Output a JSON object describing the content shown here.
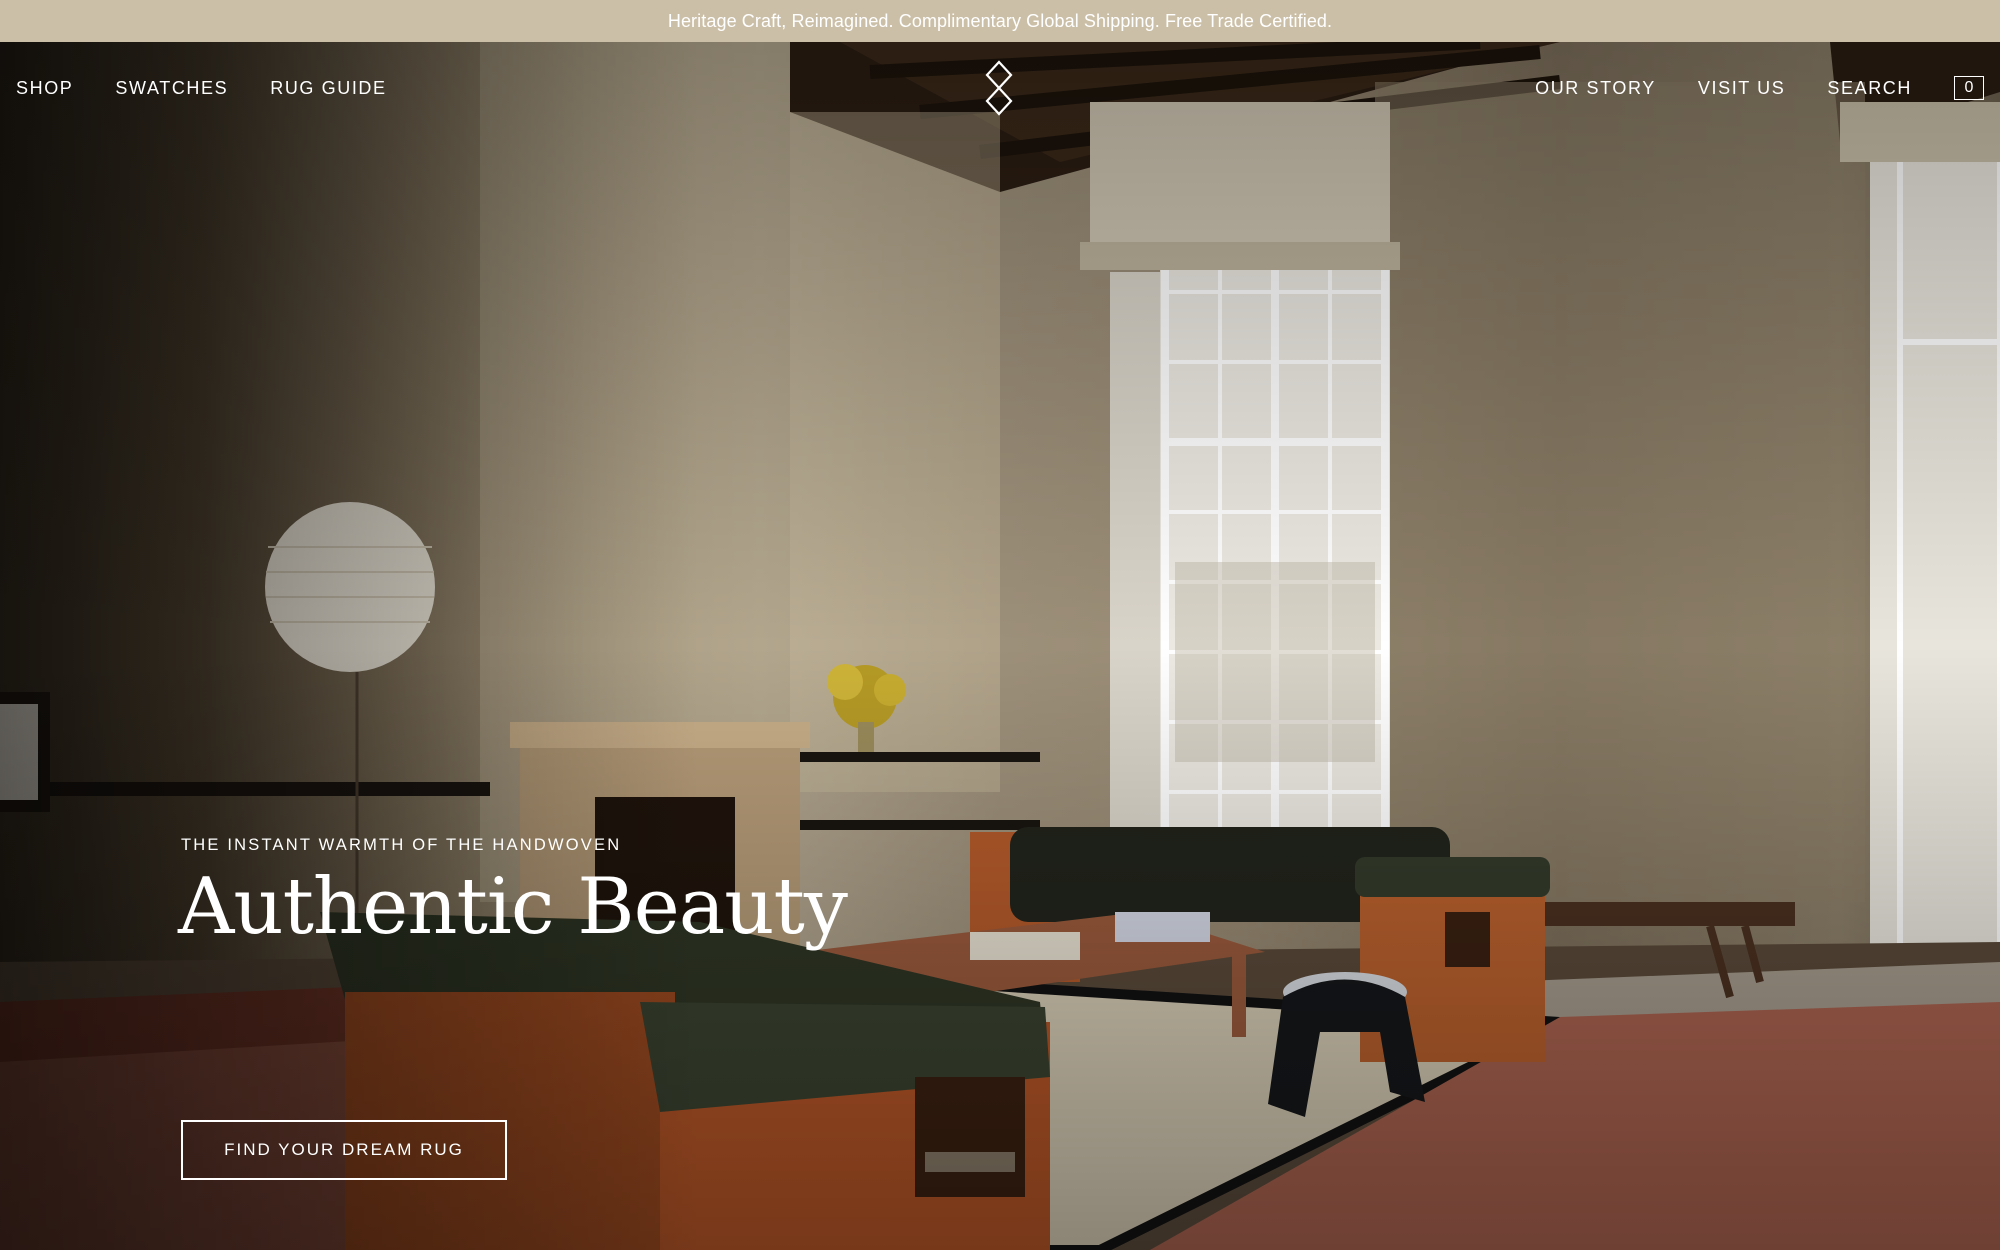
{
  "announcement": {
    "text": "Heritage Craft, Reimagined. Complimentary Global Shipping. Free Trade Certified."
  },
  "nav": {
    "left": [
      "SHOP",
      "SWATCHES",
      "RUG GUIDE"
    ],
    "right": [
      "OUR STORY",
      "VISIT US",
      "SEARCH"
    ],
    "cart_count": "0",
    "logo_icon": "diamond-logo-icon"
  },
  "hero": {
    "eyebrow": "THE INSTANT WARMTH OF THE HANDWOVEN",
    "headline": "Authentic Beauty",
    "cta_label": "FIND YOUR DREAM RUG",
    "image": "living-room-with-sofas-fireplace-and-rugs"
  },
  "colors": {
    "announcement_bg": "#ccbfa7",
    "text_on_hero": "#ffffff"
  }
}
